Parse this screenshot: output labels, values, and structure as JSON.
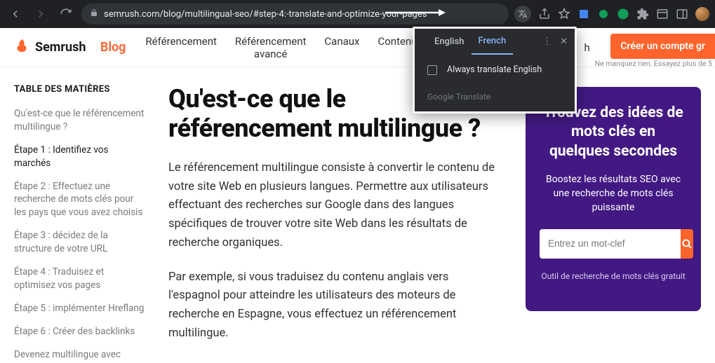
{
  "browser": {
    "url": "semrush.com/blog/multilingual-seo/#step-4:-translate-and-optimize-your-pages"
  },
  "translate_popup": {
    "tab_en": "English",
    "tab_fr": "French",
    "always_label": "Always translate English",
    "footer": "Google Translate"
  },
  "header": {
    "brand": "Semrush",
    "brand_suffix": "Blog",
    "nav": {
      "referencement": "Référencement",
      "referencement_avance_l1": "Référencement",
      "referencement_avance_l2": "avancé",
      "canaux": "Canaux",
      "contenu": "Contenu"
    },
    "search_initial": "h",
    "cta": "Créer un compte gr",
    "subcta": "Ne manquez rien. Essayez plus de 5"
  },
  "toc": {
    "title": "TABLE DES MATIÈRES",
    "items": [
      "Qu'est-ce que le référencement multilingue ?",
      "Étape 1 : Identifiez vos marchés",
      "Étape 2 : Effectuez une recherche de mots clés pour les pays que vous avez choisis",
      "Étape 3 : décidez de la structure de votre URL",
      "Étape 4 : Traduisez et optimisez vos pages",
      "Étape 5 : implémenter Hreflang",
      "Étape 6 : Créer des backlinks",
      "Devenez multilingue avec"
    ]
  },
  "article": {
    "h1": "Qu'est-ce que le référencement multilingue ?",
    "p1": "Le référencement multilingue consiste à convertir le contenu de votre site Web en plusieurs langues. Permettre aux utilisateurs effectuant des recherches sur Google dans des langues spécifiques de trouver votre site Web dans les résultats de recherche organiques.",
    "p2": "Par exemple, si vous traduisez du contenu anglais vers l'espagnol pour atteindre les utilisateurs des moteurs de recherche en Espagne, vous effectuez un référencement multilingue."
  },
  "promo": {
    "title": "Trouvez des idées de mots clés en quelques secondes",
    "subtitle": "Boostez les résultats SEO avec une recherche de mots clés puissante",
    "placeholder": "Entrez un mot-clef",
    "tool": "Outil de recherche de mots clés gratuit"
  }
}
